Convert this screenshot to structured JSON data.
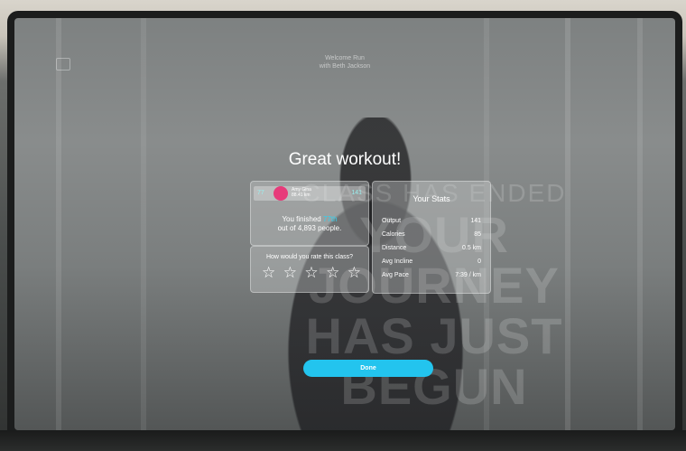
{
  "header": {
    "welcome": "Welcome Run",
    "instructor": "with Beth Jackson"
  },
  "main": {
    "title": "Great workout!"
  },
  "background_text": {
    "line1": "CLASS HAS ENDED",
    "line2": "YOUR JOURNEY",
    "line3": "HAS JUST BEGUN"
  },
  "leaderboard": {
    "rank": "77",
    "name": "Amy Gina",
    "subtitle": "88.41 km",
    "output": "141",
    "finished_prefix": "You finished ",
    "finished_rank": "77th",
    "finished_suffix": "out of 4,893 people."
  },
  "rating": {
    "question": "How would you rate this class?",
    "stars": [
      "☆",
      "☆",
      "☆",
      "☆",
      "☆"
    ]
  },
  "stats": {
    "title": "Your Stats",
    "rows": [
      {
        "label": "Output",
        "value": "141"
      },
      {
        "label": "Calories",
        "value": "85"
      },
      {
        "label": "Distance",
        "value": "0.5 km"
      },
      {
        "label": "Avg Incline",
        "value": "0"
      },
      {
        "label": "Avg Pace",
        "value": "7:39 / km"
      }
    ]
  },
  "actions": {
    "done_label": "Done"
  },
  "colors": {
    "accent": "#23c4ee",
    "avatar": "#e73b7a"
  }
}
